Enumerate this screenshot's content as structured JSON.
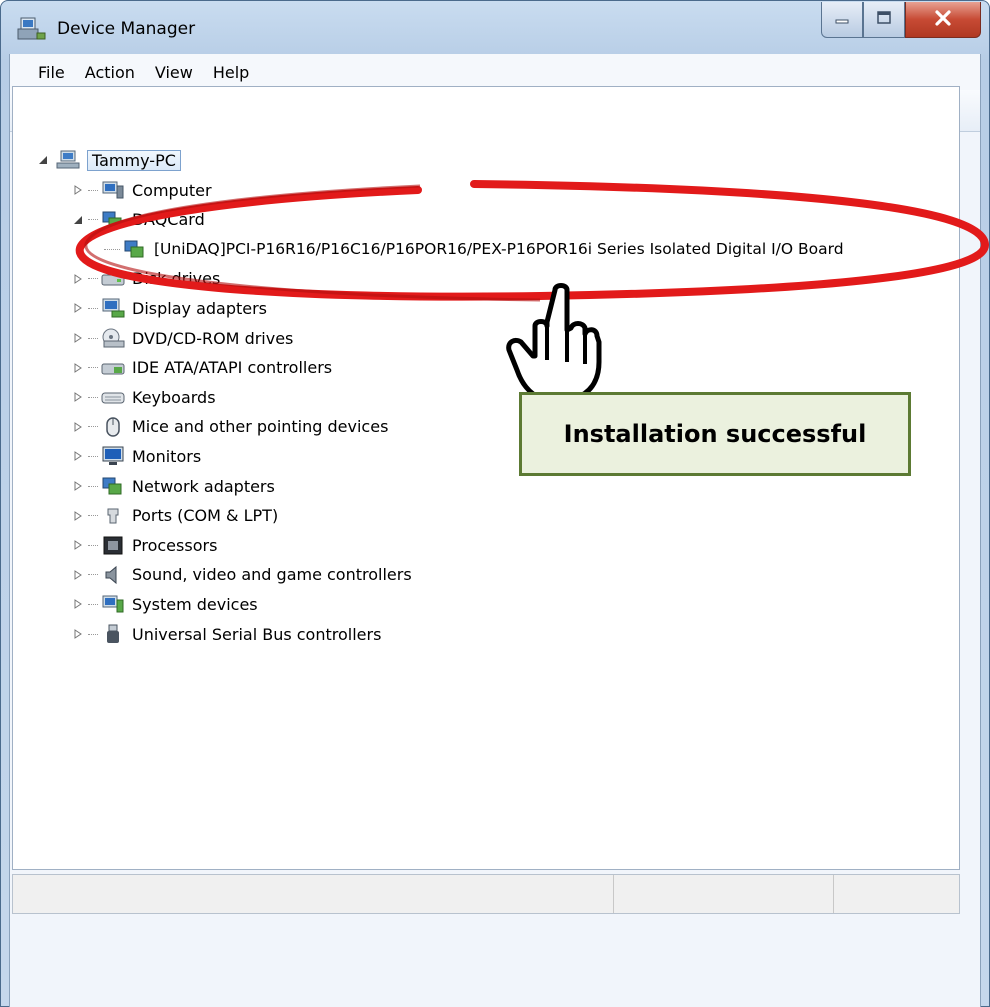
{
  "window": {
    "title": "Device Manager",
    "accent": "#b7cde6"
  },
  "menu": {
    "items": [
      "File",
      "Action",
      "View",
      "Help"
    ]
  },
  "toolbar": {
    "buttons": [
      "back-icon",
      "forward-icon",
      "properties-icon",
      "help-icon",
      "update-driver-icon",
      "scan-hardware-icon"
    ]
  },
  "tree": {
    "root": "Tammy-PC",
    "categories": [
      {
        "label": "Computer",
        "icon": "computer-icon",
        "expanded": false
      },
      {
        "label": "DAQCard",
        "icon": "daqcard-icon",
        "expanded": true,
        "children": [
          "[UniDAQ]PCI-P16R16/P16C16/P16POR16/PEX-P16POR16i Series Isolated Digital I/O Board"
        ]
      },
      {
        "label": "Disk drives",
        "icon": "disk-drive-icon",
        "expanded": false
      },
      {
        "label": "Display adapters",
        "icon": "display-adapter-icon",
        "expanded": false
      },
      {
        "label": "DVD/CD-ROM drives",
        "icon": "dvd-drive-icon",
        "expanded": false
      },
      {
        "label": "IDE ATA/ATAPI controllers",
        "icon": "ide-controller-icon",
        "expanded": false
      },
      {
        "label": "Keyboards",
        "icon": "keyboard-icon",
        "expanded": false
      },
      {
        "label": "Mice and other pointing devices",
        "icon": "mouse-icon",
        "expanded": false
      },
      {
        "label": "Monitors",
        "icon": "monitor-icon",
        "expanded": false
      },
      {
        "label": "Network adapters",
        "icon": "network-adapter-icon",
        "expanded": false
      },
      {
        "label": "Ports (COM & LPT)",
        "icon": "port-icon",
        "expanded": false
      },
      {
        "label": "Processors",
        "icon": "processor-icon",
        "expanded": false
      },
      {
        "label": "Sound, video and game controllers",
        "icon": "speaker-icon",
        "expanded": false
      },
      {
        "label": "System devices",
        "icon": "system-device-icon",
        "expanded": false
      },
      {
        "label": "Universal Serial Bus controllers",
        "icon": "usb-icon",
        "expanded": false
      }
    ]
  },
  "annotation": {
    "text": "Installation successful",
    "box_fill": "#ebf1de",
    "box_border": "#5c7a33",
    "highlight_color": "#e21a1a"
  }
}
